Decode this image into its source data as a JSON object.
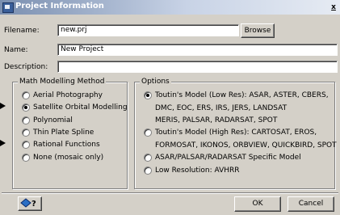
{
  "window": {
    "title": "Project Information",
    "close_label": "x"
  },
  "fields": {
    "filename_label": "Filename:",
    "filename_value": "new.prj",
    "browse_label": "Browse",
    "name_label": "Name:",
    "name_value": "New Project",
    "description_label": "Description:",
    "description_value": ""
  },
  "math_group": {
    "title": "Math Modelling Method",
    "items": [
      {
        "label": "Aerial Photography",
        "checked": false
      },
      {
        "label": "Satellite Orbital Modelling",
        "checked": true
      },
      {
        "label": "Polynomial",
        "checked": false
      },
      {
        "label": "Thin Plate Spline",
        "checked": false
      },
      {
        "label": "Rational Functions",
        "checked": false
      },
      {
        "label": "None (mosaic only)",
        "checked": false
      }
    ]
  },
  "options_group": {
    "title": "Options",
    "items": [
      {
        "checked": true,
        "lines": [
          "Toutin's Model (Low Res): ASAR, ASTER, CBERS,",
          "DMC, EOC, ERS, IRS, JERS, LANDSAT",
          "MERIS, PALSAR, RADARSAT, SPOT"
        ]
      },
      {
        "checked": false,
        "lines": [
          "Toutin's Model (High Res): CARTOSAT, EROS,",
          "FORMOSAT, IKONOS, ORBVIEW, QUICKBIRD, SPOT"
        ]
      },
      {
        "checked": false,
        "lines": [
          "ASAR/PALSAR/RADARSAT Specific Model"
        ]
      },
      {
        "checked": false,
        "lines": [
          "Low Resolution: AVHRR"
        ]
      }
    ]
  },
  "footer": {
    "help_icon": "help-pointer-icon",
    "ok_label": "OK",
    "cancel_label": "Cancel"
  },
  "colors": {
    "dialog_bg": "#d4d0c8",
    "title_bar": "#7a8fb0"
  }
}
